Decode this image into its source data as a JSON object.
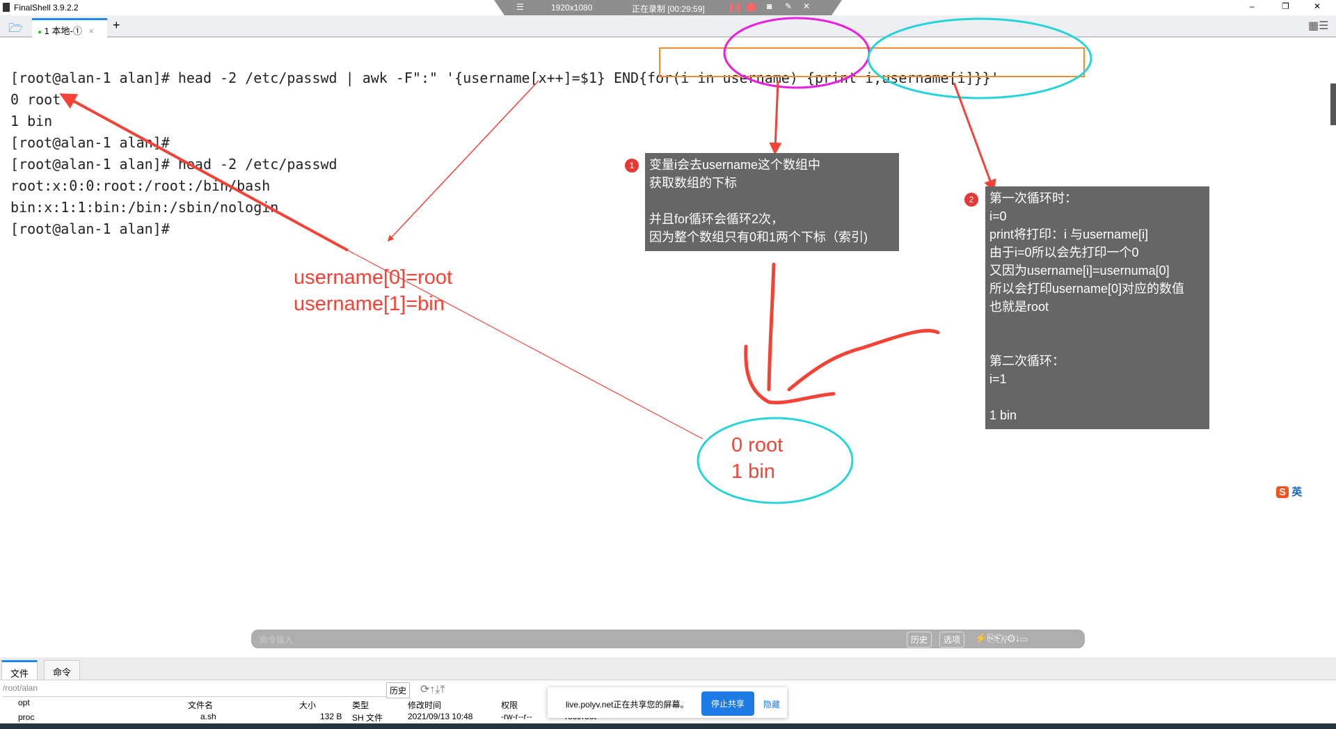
{
  "window": {
    "title": "FinalShell 3.9.2.2"
  },
  "recorder": {
    "resolution": "1920x1080",
    "status": "正在录制 [00:29:59]"
  },
  "tabs": [
    {
      "label": "1 本地-①"
    }
  ],
  "terminal": {
    "lines": [
      "[root@alan-1 alan]# head -2 /etc/passwd | awk -F\":\" '{username[x++]=$1} END{for(i in username) {print i,username[i]}}'",
      "0 root",
      "1 bin",
      "[root@alan-1 alan]#",
      "[root@alan-1 alan]# head -2 /etc/passwd",
      "root:x:0:0:root:/root:/bin/bash",
      "bin:x:1:1:bin:/bin:/sbin/nologin",
      "[root@alan-1 alan]#"
    ]
  },
  "annotations": {
    "note1": {
      "badge": "1",
      "text": "变量i会去username这个数组中\n获取数组的下标\n\n并且for循环会循环2次，\n因为整个数组只有0和1两个下标（索引)"
    },
    "note2": {
      "badge": "2",
      "text": "第一次循环时：\ni=0\nprint将打印：i 与username[i]\n由于i=0所以会先打印一个0\n又因为username[i]=usernuma[0]\n所以会打印username[0]对应的数值\n也就是root\n\n\n第二次循环：\ni=1\n\n1 bin"
    },
    "red_text": "username[0]=root\nusername[1]=bin",
    "result_text": "0 root\n1 bin",
    "colors": {
      "red": "#f44336",
      "magenta": "#e91ee0",
      "cyan": "#26d4d8",
      "orange": "#f28a30"
    }
  },
  "command_bar": {
    "placeholder": "命令输入",
    "history": "历史",
    "options": "选项"
  },
  "bottom_panel": {
    "tabs": [
      "文件",
      "命令"
    ],
    "path": "/root/alan",
    "history": "历史",
    "tree": [
      "opt",
      "proc"
    ],
    "columns": [
      "文件名",
      "大小",
      "类型",
      "修改时间",
      "权限"
    ],
    "rows": [
      {
        "name": "a.sh",
        "size": "132 B",
        "type": "SH 文件",
        "mtime": "2021/09/13 10:48",
        "perm": "-rw-r--r--",
        "owner": "root/root"
      }
    ]
  },
  "share_popup": {
    "text": "live.polyv.net正在共享您的屏幕。",
    "stop": "停止共享",
    "hide": "隐藏"
  },
  "ime": {
    "label": "英"
  }
}
